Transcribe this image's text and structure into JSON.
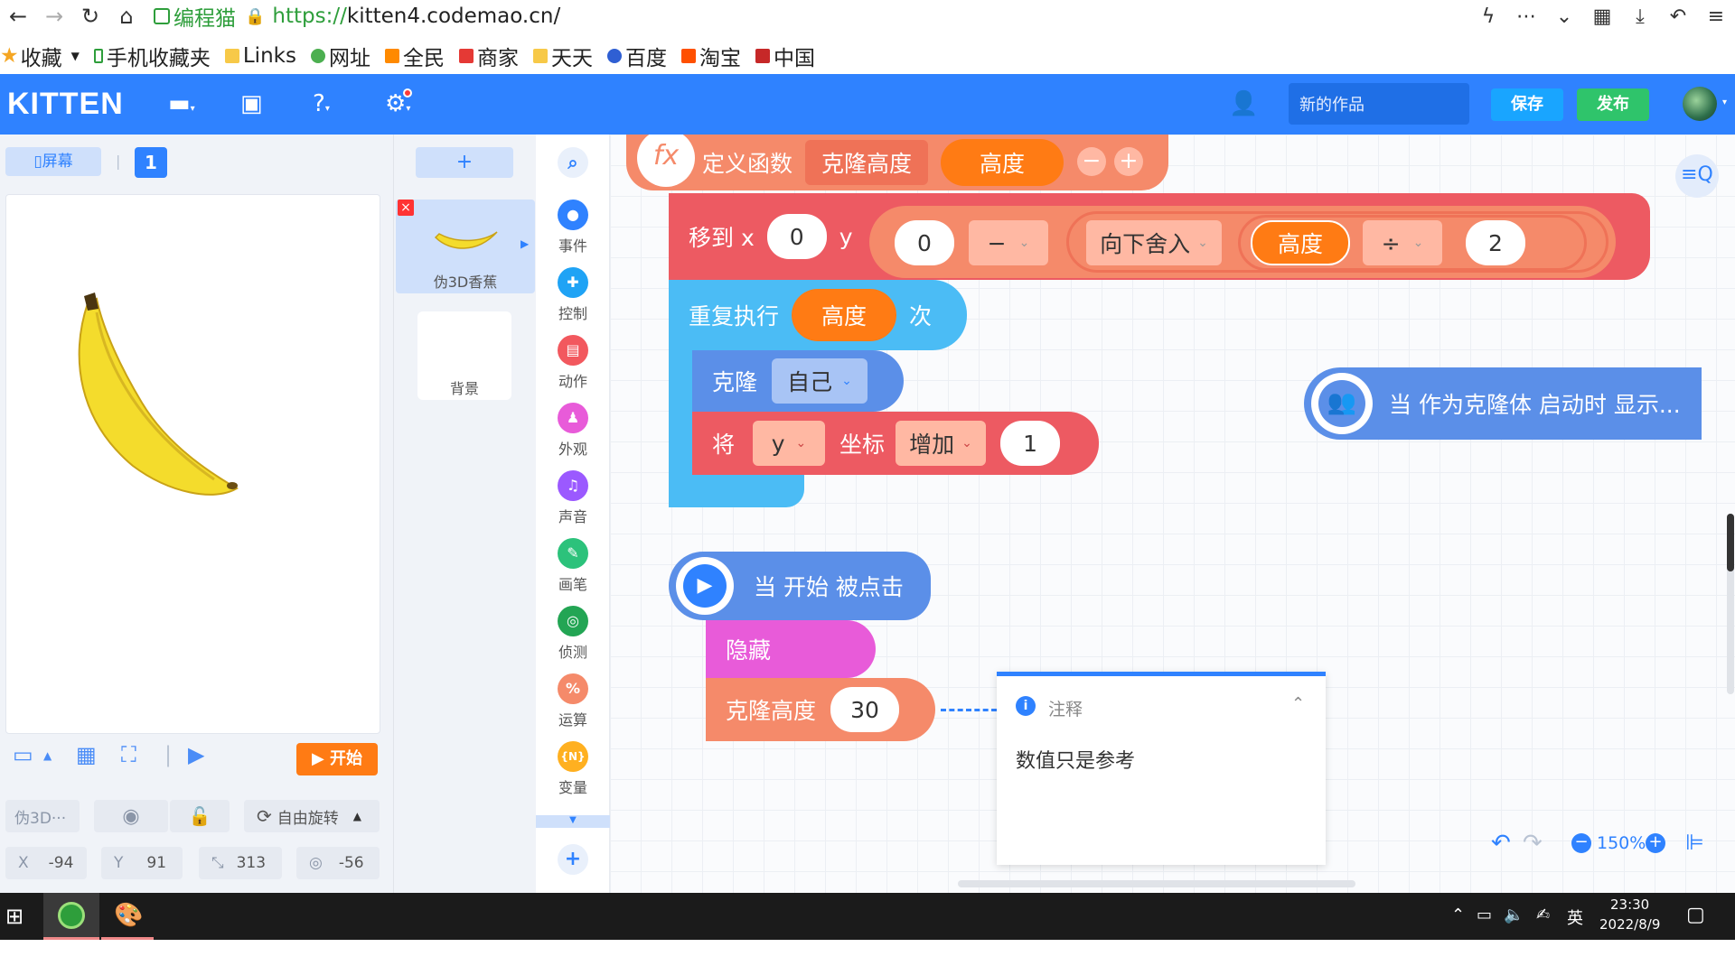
{
  "browser": {
    "site_name": "编程猫",
    "url_scheme": "https://",
    "url_rest": "kitten4.codemao.cn/",
    "bookmarks": [
      "收藏",
      "手机收藏夹",
      "Links",
      "网址",
      "全民",
      "商家",
      "天天",
      "百度",
      "淘宝",
      "中国"
    ]
  },
  "header": {
    "logo": "KITTEN",
    "title_placeholder": "新的作品",
    "save_label": "保存",
    "publish_label": "发布"
  },
  "stage": {
    "screen_label": "屏幕",
    "screen_number": "1",
    "start_label": "开始",
    "sprite_short_name": "伪3D···",
    "rotation_label": "自由旋转",
    "x_label": "X",
    "x_value": "-94",
    "y_label": "Y",
    "y_value": "91",
    "size_value": "313",
    "angle_value": "-56"
  },
  "sprites": {
    "add_label": "+",
    "sprite_name": "伪3D香蕉",
    "background_name": "背景"
  },
  "categories": [
    "事件",
    "控制",
    "动作",
    "外观",
    "声音",
    "画笔",
    "侦测",
    "运算",
    "变量"
  ],
  "blocks": {
    "define_label": "定义函数",
    "func_name": "克隆高度",
    "param": "高度",
    "move_to_x": "移到 x",
    "x_val": "0",
    "y_label": "y",
    "y_a": "0",
    "minus_op": "−",
    "floor_label": "向下舍入",
    "height_var": "高度",
    "div_op": "÷",
    "div_val": "2",
    "repeat_label": "重复执行",
    "repeat_var": "高度",
    "times_label": "次",
    "clone_label": "克隆",
    "clone_target": "自己",
    "set_label": "将",
    "axis": "y",
    "coord_label": "坐标",
    "change_label": "增加",
    "change_val": "1",
    "clone_start_label": "当 作为克隆体 启动时 显示...",
    "when_start_label": "当 开始 被点击",
    "hide_label": "隐藏",
    "call_func": "克隆高度",
    "call_val": "30"
  },
  "comment": {
    "title": "注释",
    "text": "数值只是参考"
  },
  "zoom": {
    "level": "150%"
  },
  "taskbar": {
    "ime": "英",
    "time": "23:30",
    "date": "2022/8/9"
  }
}
